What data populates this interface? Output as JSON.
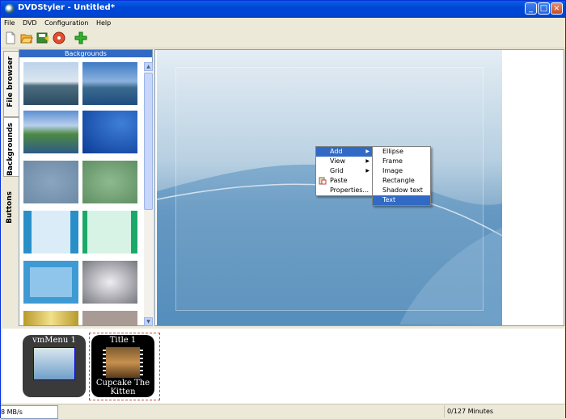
{
  "window": {
    "title": "DVDStyler - Untitled*"
  },
  "menubar": [
    "File",
    "DVD",
    "Configuration",
    "Help"
  ],
  "toolbar": {
    "buttons": [
      "new-icon",
      "open-icon",
      "save-icon",
      "burn-icon",
      "add-icon"
    ]
  },
  "sidebar": {
    "tabs": [
      {
        "label": "File browser",
        "active": false
      },
      {
        "label": "Backgrounds",
        "active": true
      },
      {
        "label": "Buttons",
        "active": false
      }
    ],
    "panel_title": "Backgrounds"
  },
  "context_menu": {
    "items": [
      {
        "label": "Add",
        "submenu": true,
        "selected": true
      },
      {
        "label": "View",
        "submenu": true
      },
      {
        "label": "Grid",
        "submenu": true
      },
      {
        "label": "Paste",
        "icon": "paste-icon"
      },
      {
        "label": "Properties..."
      }
    ],
    "submenu": [
      "Ellipse",
      "Frame",
      "Image",
      "Rectangle",
      "Shadow text",
      "Text"
    ],
    "submenu_selected": "Text"
  },
  "titles": [
    {
      "caption": "vmMenu 1"
    },
    {
      "caption": "Title 1",
      "subtitle": "Cupcake The Kitten"
    }
  ],
  "status": {
    "rate": "8 MB/s",
    "duration": "0/127 Minutes"
  },
  "colors": {
    "title_bar": "#0054e3",
    "selection": "#316ac5",
    "tile_bg": "#3a3a3a"
  }
}
